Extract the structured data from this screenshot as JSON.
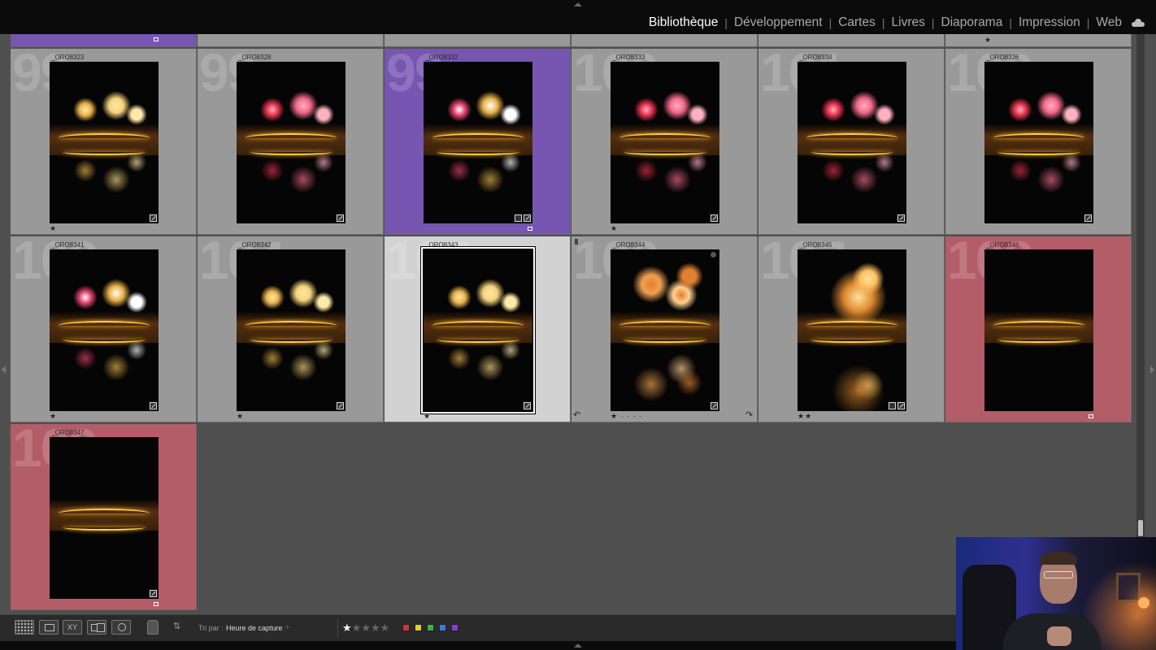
{
  "app": {
    "modules": [
      {
        "label": "Bibliothèque",
        "active": true
      },
      {
        "label": "Développement",
        "active": false
      },
      {
        "label": "Cartes",
        "active": false
      },
      {
        "label": "Livres",
        "active": false
      },
      {
        "label": "Diaporama",
        "active": false
      },
      {
        "label": "Impression",
        "active": false
      },
      {
        "label": "Web",
        "active": false
      }
    ],
    "cloud_icon": "cloud-icon"
  },
  "grid": {
    "top_partial": [
      {
        "color": "purple",
        "flag_label": "purple"
      },
      {
        "color": "none"
      },
      {
        "color": "none"
      },
      {
        "color": "none"
      },
      {
        "color": "none"
      },
      {
        "color": "none",
        "stars": "★"
      }
    ],
    "cells": [
      {
        "index": "99",
        "filename": "_ORO8323",
        "label_color": "none",
        "stars": "★",
        "scene": "gold",
        "selected": false
      },
      {
        "index": "99",
        "filename": "_ORO8328",
        "label_color": "none",
        "stars": "",
        "scene": "red",
        "selected": false
      },
      {
        "index": "99",
        "filename": "_ORO8332",
        "label_color": "purple",
        "stars": "",
        "scene": "mixed",
        "selected": false,
        "extra_badge": true,
        "flag_square": "#7656b1"
      },
      {
        "index": "100",
        "filename": "_ORO8333",
        "label_color": "none",
        "stars": "★",
        "scene": "red",
        "selected": false
      },
      {
        "index": "101",
        "filename": "_ORO8334",
        "label_color": "none",
        "stars": "",
        "scene": "red",
        "selected": false
      },
      {
        "index": "102",
        "filename": "_ORO8336",
        "label_color": "none",
        "stars": "",
        "scene": "red",
        "selected": false
      },
      {
        "index": "103",
        "filename": "_ORO8341",
        "label_color": "none",
        "stars": "★",
        "scene": "mixed",
        "selected": false
      },
      {
        "index": "104",
        "filename": "_ORO8342",
        "label_color": "none",
        "stars": "★",
        "scene": "gold",
        "selected": false
      },
      {
        "index": "105",
        "filename": "_ORO8343",
        "label_color": "none",
        "stars": "★",
        "scene": "gold",
        "selected": true
      },
      {
        "index": "106",
        "filename": "_ORO8344",
        "label_color": "none",
        "stars": "★ · · · ·",
        "scene": "orange",
        "selected": false,
        "rotate_icons": true,
        "dot": true,
        "pick_flag": true
      },
      {
        "index": "107",
        "filename": "_ORO8345",
        "label_color": "none",
        "stars": "★★",
        "scene": "orange-big",
        "selected": false,
        "extra_badge": true
      },
      {
        "index": "108",
        "filename": "_ORO8346",
        "label_color": "red",
        "stars": "",
        "scene": "dim",
        "selected": false,
        "no_badge": true,
        "flag_square": "#b35d68"
      },
      {
        "index": "109",
        "filename": "_ORO8347",
        "label_color": "red",
        "stars": "",
        "scene": "dim",
        "selected": false,
        "flag_square": "#b35d68"
      }
    ]
  },
  "toolbar": {
    "sort_label": "Tri par :",
    "sort_value": "Heure de capture",
    "sort_caret": "÷",
    "xy_label": "XY",
    "rating_filter": 1,
    "rating_max": 5,
    "color_filters": [
      "#d6303a",
      "#d8d230",
      "#39b34a",
      "#3a7ad8",
      "#8a3ad8"
    ]
  },
  "colors": {
    "purple_label": "#7656b1",
    "red_label": "#b35d68",
    "cell_bg": "#999999",
    "selected_bg": "#d2d2d2",
    "grid_bg": "#505050"
  }
}
